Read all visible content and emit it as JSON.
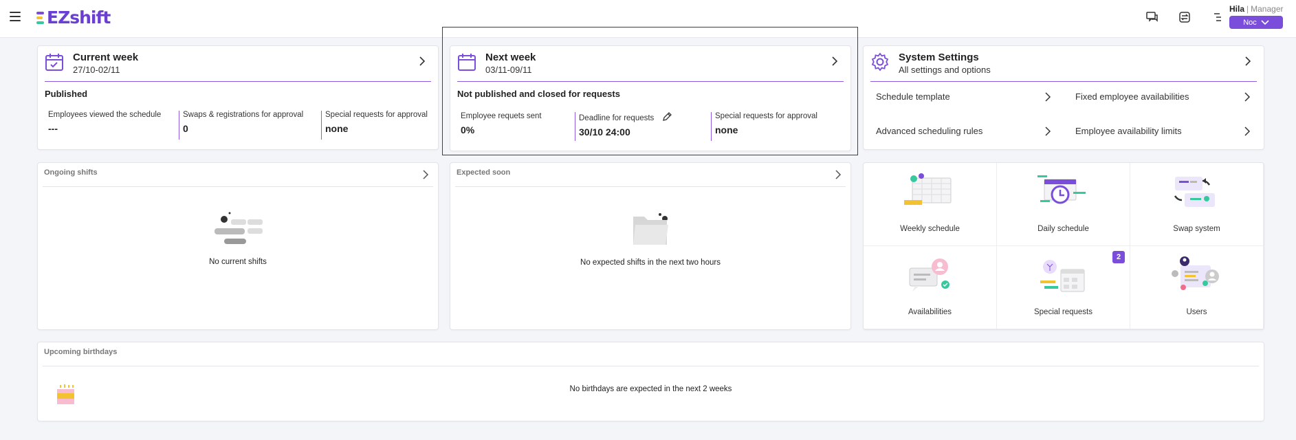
{
  "app": {
    "logo_text": "EZshift"
  },
  "user": {
    "name": "Hila",
    "separator": "|",
    "role": "Manager",
    "org": "Noc"
  },
  "current_week": {
    "title": "Current week",
    "dates": "27/10-02/11",
    "status": "Published",
    "stats": [
      {
        "label": "Employees viewed the schedule",
        "value": "---"
      },
      {
        "label": "Swaps & registrations for approval",
        "value": "0"
      },
      {
        "label": "Special requests for approval",
        "value": "none"
      }
    ]
  },
  "next_week": {
    "title": "Next week",
    "dates": "03/11-09/11",
    "status": "Not published and closed for requests",
    "stats": [
      {
        "label": "Employee requets sent",
        "value": "0%"
      },
      {
        "label": "Deadline for requests",
        "value": "30/10 24:00"
      },
      {
        "label": "Special requests for approval",
        "value": "none"
      }
    ]
  },
  "system_settings": {
    "title": "System Settings",
    "subtitle": "All settings and options",
    "links": [
      "Schedule template",
      "Fixed employee availabilities",
      "Advanced scheduling rules",
      "Employee availability limits"
    ]
  },
  "ongoing_shifts": {
    "title": "Ongoing shifts",
    "empty": "No current shifts"
  },
  "expected_soon": {
    "title": "Expected soon",
    "empty": "No expected shifts in the next two hours"
  },
  "tiles": [
    {
      "label": "Weekly schedule",
      "icon": "weekly-schedule-icon"
    },
    {
      "label": "Daily schedule",
      "icon": "daily-schedule-icon"
    },
    {
      "label": "Swap system",
      "icon": "swap-system-icon"
    },
    {
      "label": "Availabilities",
      "icon": "availabilities-icon"
    },
    {
      "label": "Special requests",
      "icon": "special-requests-icon",
      "badge": "2"
    },
    {
      "label": "Users",
      "icon": "users-icon"
    }
  ],
  "birthdays": {
    "title": "Upcoming birthdays",
    "empty": "No birthdays are expected in the next 2 weeks"
  },
  "colors": {
    "accent": "#7b4ddb",
    "highlight_border": "#8b1c2c"
  }
}
